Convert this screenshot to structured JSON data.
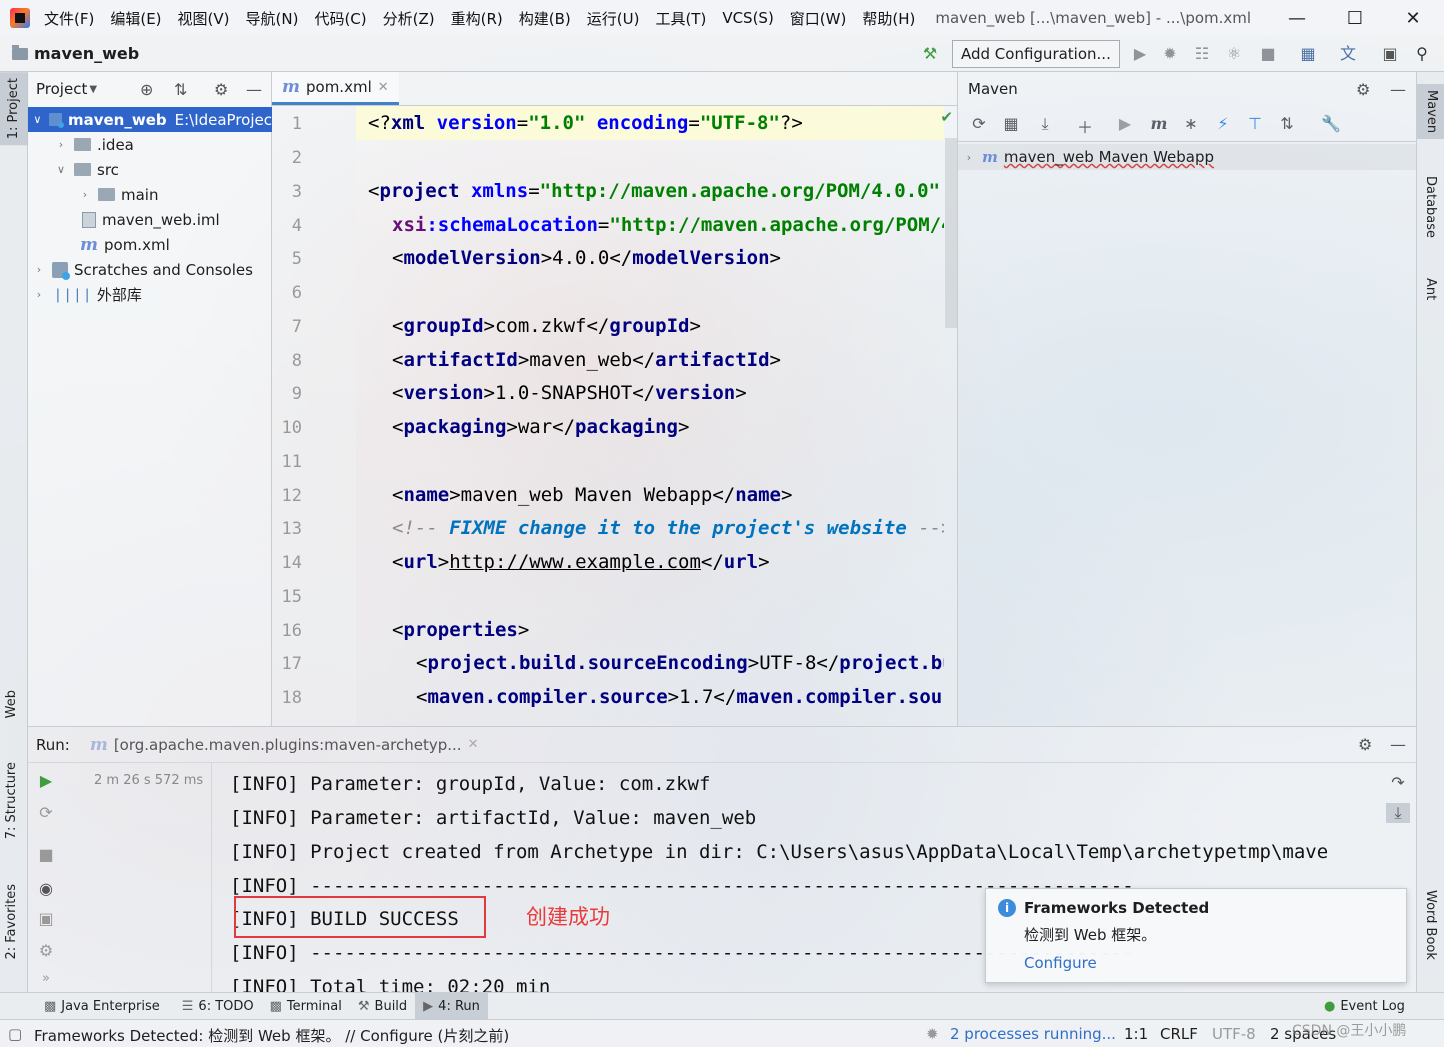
{
  "titlebar": {
    "menus": [
      "文件(F)",
      "编辑(E)",
      "视图(V)",
      "导航(N)",
      "代码(C)",
      "分析(Z)",
      "重构(R)",
      "构建(B)",
      "运行(U)",
      "工具(T)",
      "VCS(S)",
      "窗口(W)",
      "帮助(H)"
    ],
    "title": "maven_web [...\\maven_web] - ...\\pom.xml"
  },
  "navbar": {
    "project": "maven_web",
    "add_config": "Add Configuration..."
  },
  "left_stripe": {
    "project_tab": "1: Project",
    "web_tab": "Web",
    "structure_tab": "7: Structure",
    "favorites_tab": "2: Favorites"
  },
  "right_stripe": {
    "maven_tab": "Maven",
    "database_tab": "Database",
    "ant_tab": "Ant",
    "wordbook_tab": "Word Book"
  },
  "project_panel": {
    "title": "Project",
    "tree": [
      {
        "label": "maven_web",
        "path": "E:\\IdeaProjec"
      },
      {
        "label": ".idea"
      },
      {
        "label": "src"
      },
      {
        "label": "main"
      },
      {
        "label": "maven_web.iml"
      },
      {
        "label": "pom.xml"
      },
      {
        "label": "Scratches and Consoles"
      },
      {
        "label": "外部库"
      }
    ]
  },
  "editor": {
    "tab": "pom.xml",
    "line_numbers": [
      "1",
      "2",
      "3",
      "4",
      "5",
      "6",
      "7",
      "8",
      "9",
      "10",
      "11",
      "12",
      "13",
      "14",
      "15",
      "16",
      "17",
      "18"
    ]
  },
  "maven_panel": {
    "title": "Maven",
    "project": "maven_web Maven Webapp"
  },
  "run_panel": {
    "label": "Run:",
    "tab": "[org.apache.maven.plugins:maven-archetyp...",
    "time": "2 m 26 s 572 ms",
    "console": [
      "[INFO] Parameter: groupId, Value: com.zkwf",
      "[INFO] Parameter: artifactId, Value: maven_web",
      "[INFO] Project created from Archetype in dir: C:\\Users\\asus\\AppData\\Local\\Temp\\archetypetmp\\mave",
      "[INFO] ------------------------------------------------------------------------",
      "[INFO] BUILD SUCCESS",
      "[INFO] ------------------------------------------------------------------------",
      "[INFO] Total time: 02:20 min"
    ],
    "annotation": "创建成功"
  },
  "notification": {
    "title": "Frameworks Detected",
    "body": "检测到 Web 框架。",
    "link": "Configure"
  },
  "bottom_tabs": {
    "java_enterprise": "Java Enterprise",
    "todo": "6: TODO",
    "terminal": "Terminal",
    "build": "Build",
    "run": "4: Run",
    "event_log": "Event Log"
  },
  "statusbar": {
    "message": "Frameworks Detected: 检测到 Web 框架。 // Configure (片刻之前)",
    "processes": "2 processes running...",
    "position": "1:1",
    "line_sep": "CRLF",
    "encoding": "UTF-8",
    "indent": "2 spaces",
    "watermark": "CSDN @王小小鹏"
  },
  "colors": {
    "selection": "#2f65ca",
    "tag": "#000080",
    "string": "#008000",
    "annotation_red": "#e0393e",
    "link": "#2f6fc9"
  }
}
